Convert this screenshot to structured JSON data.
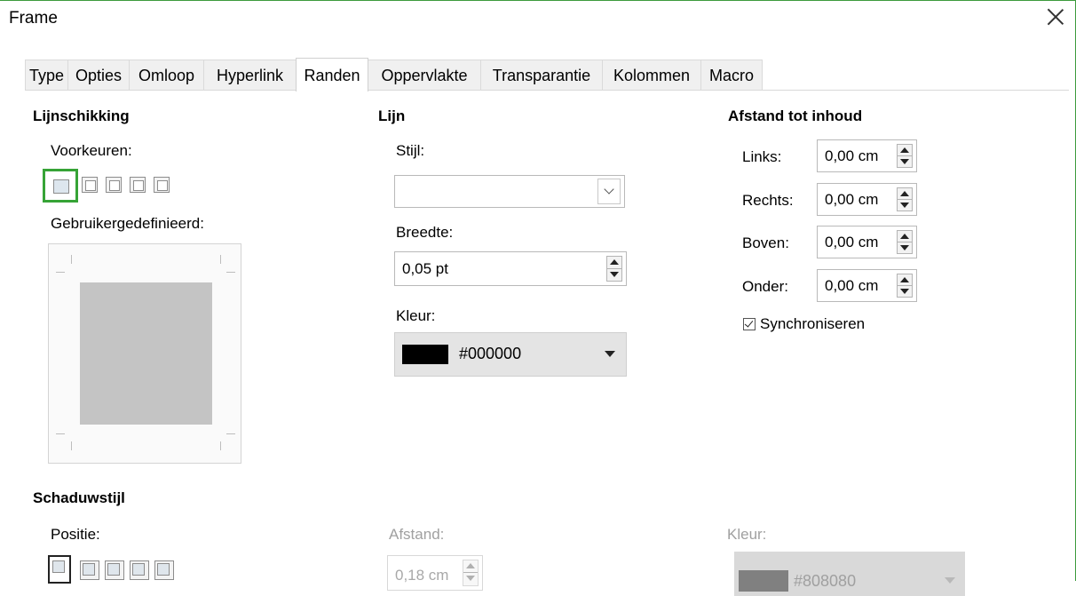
{
  "window": {
    "title": "Frame"
  },
  "tabs": [
    {
      "label": "Type"
    },
    {
      "label": "Opties"
    },
    {
      "label": "Omloop"
    },
    {
      "label": "Hyperlink"
    },
    {
      "label": "Randen"
    },
    {
      "label": "Oppervlakte"
    },
    {
      "label": "Transparantie"
    },
    {
      "label": "Kolommen"
    },
    {
      "label": "Macro"
    }
  ],
  "active_tab": "Randen",
  "line_arrangement": {
    "heading": "Lijnschikking",
    "presets_label": "Voorkeuren:",
    "preset_count": 5,
    "selected_preset": 1,
    "user_defined_label": "Gebruikergedefinieerd:"
  },
  "line": {
    "heading": "Lijn",
    "style_label": "Stijl:",
    "style_value": "",
    "width_label": "Breedte:",
    "width_value": "0,05 pt",
    "color_label": "Kleur:",
    "color_value": "#000000",
    "color_swatch": "#000000"
  },
  "padding": {
    "heading": "Afstand tot inhoud",
    "left_label": "Links:",
    "left_value": "0,00 cm",
    "right_label": "Rechts:",
    "right_value": "0,00 cm",
    "top_label": "Boven:",
    "top_value": "0,00 cm",
    "bottom_label": "Onder:",
    "bottom_value": "0,00 cm",
    "sync_label": "Synchroniseren",
    "sync_checked": true
  },
  "shadow": {
    "heading": "Schaduwstijl",
    "position_label": "Positie:",
    "distance_label": "Afstand:",
    "distance_value": "0,18 cm",
    "color_label": "Kleur:",
    "color_value": "#808080",
    "color_swatch": "#808080"
  },
  "colors": {
    "accent": "#36a336",
    "tab_border": "#dadada"
  }
}
